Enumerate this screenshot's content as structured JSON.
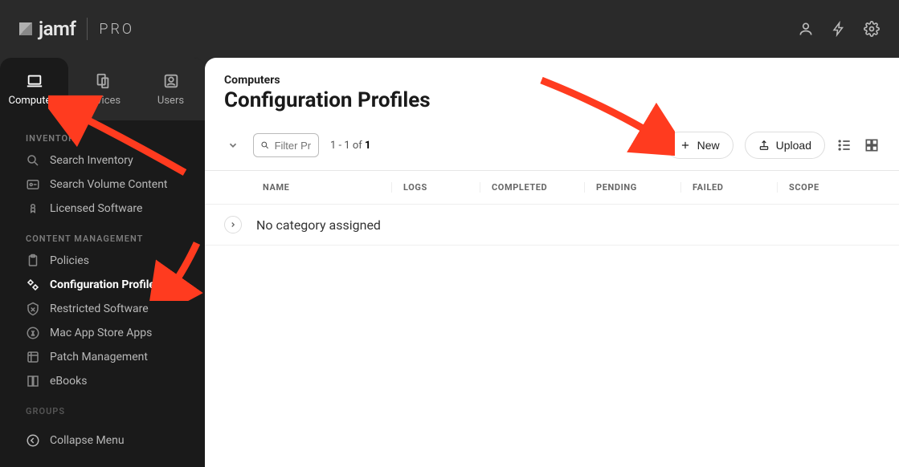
{
  "brand": {
    "name": "jamf",
    "sub": "PRO"
  },
  "tabs": {
    "computers": "Computers",
    "devices": "Devices",
    "users": "Users"
  },
  "sections": {
    "inventory": {
      "label": "INVENTORY",
      "items": [
        {
          "icon": "search",
          "label": "Search Inventory"
        },
        {
          "icon": "volume",
          "label": "Search Volume Content"
        },
        {
          "icon": "license",
          "label": "Licensed Software"
        }
      ]
    },
    "content": {
      "label": "CONTENT MANAGEMENT",
      "items": [
        {
          "icon": "clipboard",
          "label": "Policies"
        },
        {
          "icon": "gears",
          "label": "Configuration Profiles",
          "active": true
        },
        {
          "icon": "shield",
          "label": "Restricted Software"
        },
        {
          "icon": "appstore",
          "label": "Mac App Store Apps"
        },
        {
          "icon": "patch",
          "label": "Patch Management"
        },
        {
          "icon": "book",
          "label": "eBooks"
        }
      ]
    },
    "groups": {
      "label": "GROUPS"
    }
  },
  "collapse": "Collapse Menu",
  "header": {
    "breadcrumb": "Computers",
    "title": "Configuration Profiles"
  },
  "toolbar": {
    "filter_placeholder": "Filter Pr",
    "count_prefix": "1 - 1 of ",
    "count_total": "1",
    "new_label": "New",
    "upload_label": "Upload"
  },
  "columns": {
    "name": "NAME",
    "logs": "LOGS",
    "completed": "COMPLETED",
    "pending": "PENDING",
    "failed": "FAILED",
    "scope": "SCOPE"
  },
  "category_row": "No category assigned"
}
